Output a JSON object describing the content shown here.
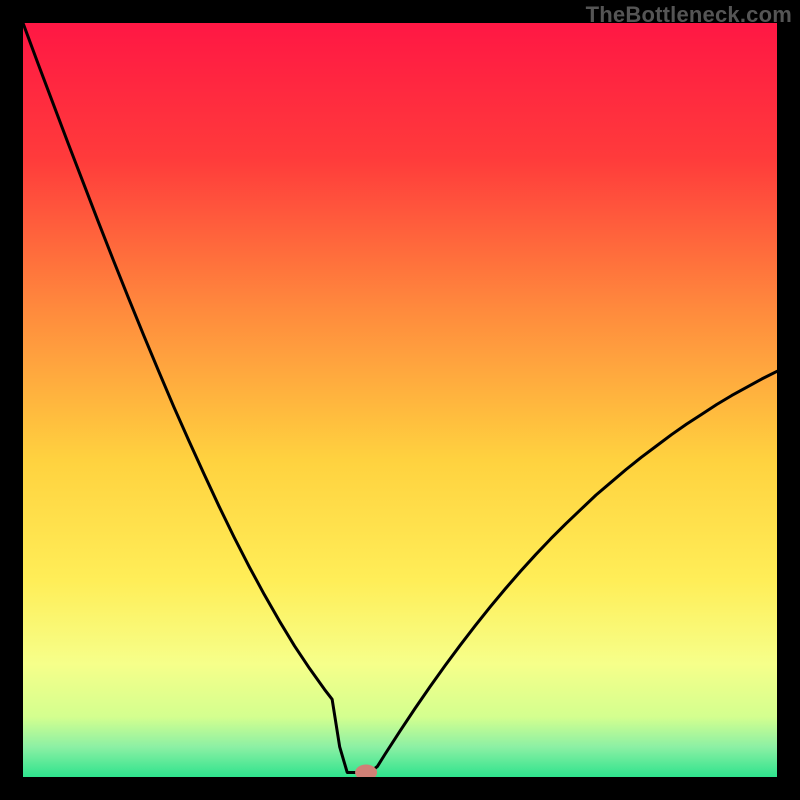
{
  "watermark": "TheBottleneck.com",
  "chart_data": {
    "type": "line",
    "title": "",
    "xlabel": "",
    "ylabel": "",
    "xlim": [
      0,
      100
    ],
    "ylim": [
      0,
      100
    ],
    "x": [
      0,
      2,
      4,
      6,
      8,
      10,
      12,
      14,
      16,
      18,
      20,
      22,
      24,
      26,
      28,
      30,
      32,
      34,
      36,
      38,
      40,
      41,
      42,
      43,
      44,
      45,
      46,
      47,
      48,
      50,
      52,
      54,
      56,
      58,
      60,
      62,
      64,
      66,
      68,
      70,
      72,
      74,
      76,
      78,
      80,
      82,
      84,
      86,
      88,
      90,
      92,
      94,
      96,
      98,
      100
    ],
    "values": [
      100,
      94.6,
      89.3,
      84.0,
      78.8,
      73.6,
      68.5,
      63.5,
      58.6,
      53.8,
      49.1,
      44.6,
      40.2,
      35.9,
      31.8,
      27.9,
      24.2,
      20.7,
      17.4,
      14.4,
      11.6,
      10.3,
      4.0,
      0.6,
      0.6,
      0.6,
      0.6,
      1.4,
      3.0,
      6.1,
      9.1,
      12.0,
      14.8,
      17.5,
      20.1,
      22.6,
      25.0,
      27.3,
      29.5,
      31.6,
      33.6,
      35.5,
      37.4,
      39.1,
      40.8,
      42.4,
      43.9,
      45.4,
      46.8,
      48.1,
      49.4,
      50.6,
      51.7,
      52.8,
      53.8
    ],
    "notch_bottom_plateau_x": [
      42.8,
      46.4
    ],
    "marker": {
      "x": 45.5,
      "y": 0.6
    },
    "gradient_stops": [
      {
        "pct": 0,
        "color": "#ff1744"
      },
      {
        "pct": 18,
        "color": "#ff3b3b"
      },
      {
        "pct": 38,
        "color": "#ff8a3d"
      },
      {
        "pct": 58,
        "color": "#ffd23f"
      },
      {
        "pct": 74,
        "color": "#ffee58"
      },
      {
        "pct": 85,
        "color": "#f6ff8a"
      },
      {
        "pct": 92,
        "color": "#d4ff8f"
      },
      {
        "pct": 96,
        "color": "#8cf0a4"
      },
      {
        "pct": 100,
        "color": "#2ee38d"
      }
    ],
    "marker_color": "#d08076",
    "curve_color": "#000000",
    "curve_width": 3
  }
}
